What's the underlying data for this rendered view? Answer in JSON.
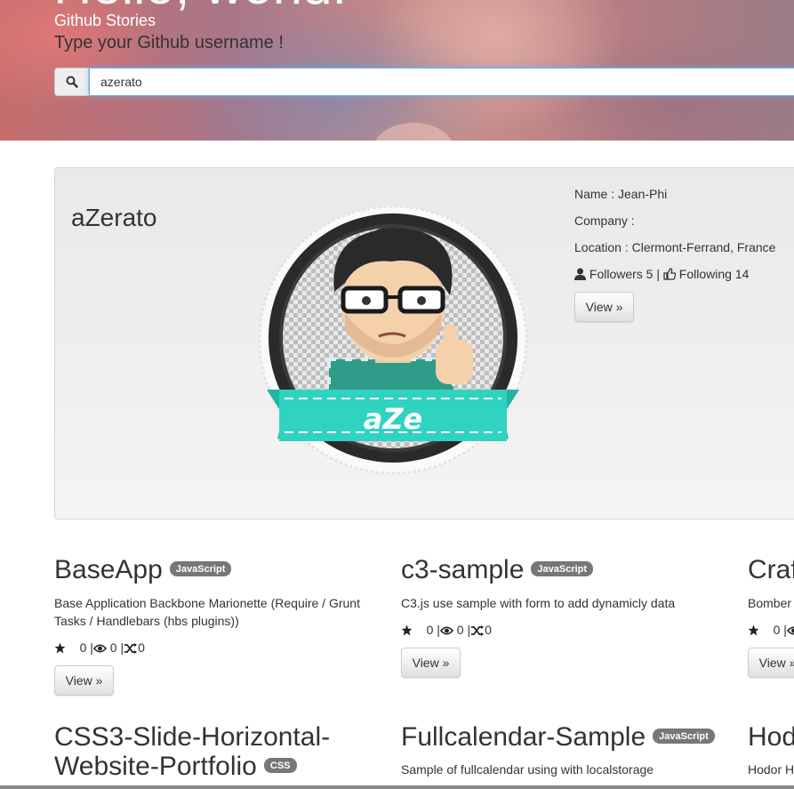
{
  "hero": {
    "big_heading": "Hello, world!",
    "brand": "Github Stories",
    "subtitle": "Type your Github username !",
    "search_value": "azerato",
    "search_icon": "search-icon"
  },
  "profile": {
    "username": "aZerato",
    "avatar_badge": "aZe",
    "name": "Name : Jean-Phi",
    "company": "Company :",
    "location": "Location : Clermont-Ferrand, France",
    "followers": "Followers 5",
    "separator": "|",
    "following": "Following 14",
    "view_label": "View »"
  },
  "repos": [
    {
      "title": "BaseApp",
      "language": "JavaScript",
      "description": "Base Application Backbone Marionette (Require / Grunt Tasks / Handlebars (hbs plugins))",
      "stars": "0",
      "watchers": "0",
      "forks": "0",
      "view_label": "View »"
    },
    {
      "title": "c3-sample",
      "language": "JavaScript",
      "description": "C3.js use sample with form to add dynamicly data",
      "stars": "0",
      "watchers": "0",
      "forks": "0",
      "view_label": "View »"
    },
    {
      "title": "Craf",
      "language": "",
      "description": "Bomber",
      "stars": "0",
      "view_label": "View »"
    },
    {
      "title_line1": "CSS3-Slide-Horizontal-",
      "title_line2": "Website-Portfolio",
      "language": "CSS"
    },
    {
      "title": "Fullcalendar-Sample",
      "language": "JavaScript",
      "description": "Sample of fullcalendar using with localstorage"
    },
    {
      "title": "Hod",
      "description": "Hodor H"
    }
  ],
  "colors": {
    "label_bg": "#777777",
    "input_focus": "#66afe9",
    "avatar_ribbon": "#2fd3c0"
  }
}
